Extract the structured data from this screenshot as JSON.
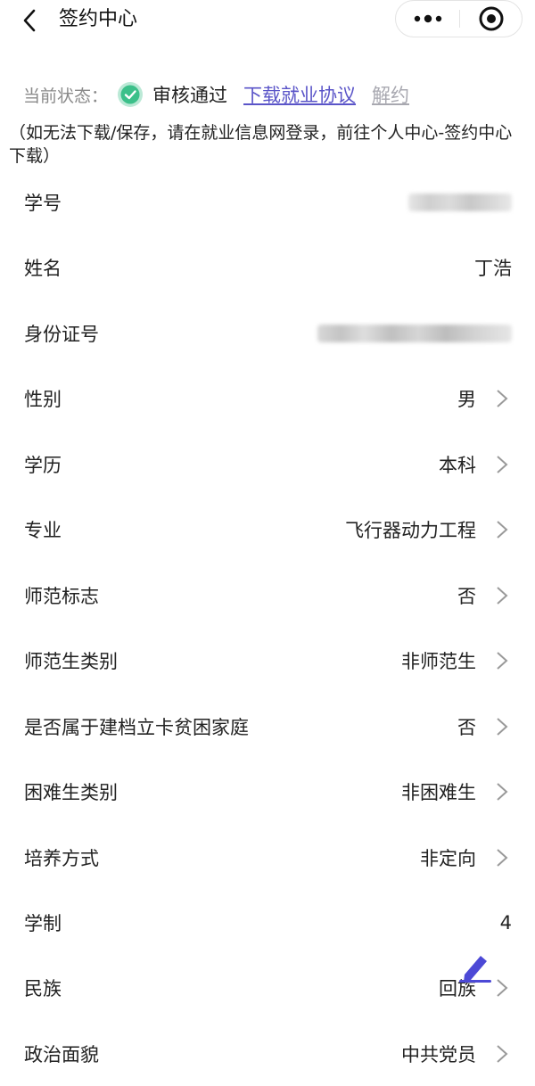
{
  "header": {
    "title": "签约中心",
    "back_icon": "chevron-left-icon",
    "more_icon": "more-dots-icon",
    "close_icon": "target-close-icon"
  },
  "status": {
    "label": "当前状态：",
    "icon": "check-circle-icon",
    "text": "审核通过",
    "download_link": "下载就业协议",
    "cancel_link": "解约",
    "accent_color": "#5a54c8",
    "check_color": "#3cc08a"
  },
  "hint": "（如无法下载/保存，请在就业信息网登录，前往个人中心-签约中心下载）",
  "rows": [
    {
      "label": "学号",
      "value": "",
      "chevron": false
    },
    {
      "label": "姓名",
      "value": "丁浩",
      "chevron": false
    },
    {
      "label": "身份证号",
      "value": "",
      "chevron": false
    },
    {
      "label": "性别",
      "value": "男",
      "chevron": true
    },
    {
      "label": "学历",
      "value": "本科",
      "chevron": true
    },
    {
      "label": "专业",
      "value": "飞行器动力工程",
      "chevron": true
    },
    {
      "label": "师范标志",
      "value": "否",
      "chevron": true
    },
    {
      "label": "师范生类别",
      "value": "非师范生",
      "chevron": true
    },
    {
      "label": "是否属于建档立卡贫困家庭",
      "value": "否",
      "chevron": true
    },
    {
      "label": "困难生类别",
      "value": "非困难生",
      "chevron": true
    },
    {
      "label": "培养方式",
      "value": "非定向",
      "chevron": true
    },
    {
      "label": "学制",
      "value": "4",
      "chevron": false
    },
    {
      "label": "民族",
      "value": "回族",
      "chevron": true
    },
    {
      "label": "政治面貌",
      "value": "中共党员",
      "chevron": true
    }
  ],
  "icons": {
    "chevron": "chevron-right-icon",
    "edit": "pen-icon"
  }
}
